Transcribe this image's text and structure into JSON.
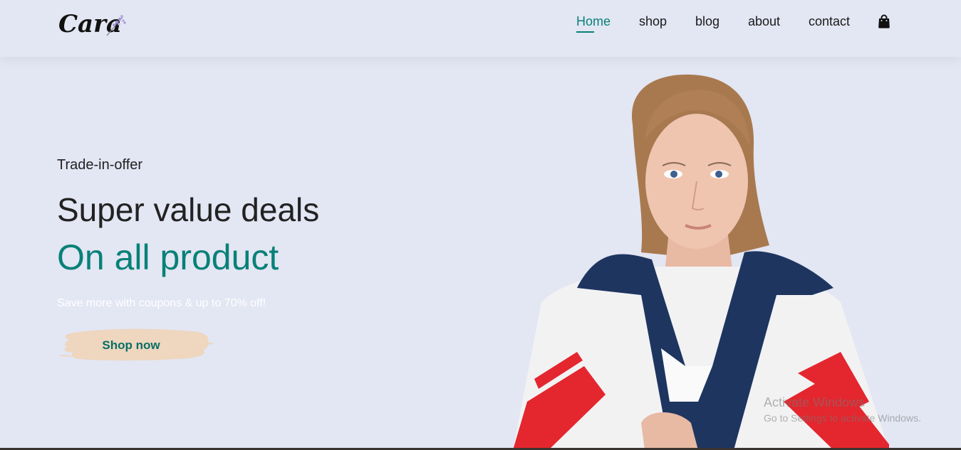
{
  "header": {
    "logo_text": "Cara",
    "nav": [
      {
        "label": "Home",
        "active": true
      },
      {
        "label": "shop"
      },
      {
        "label": "blog"
      },
      {
        "label": "about"
      },
      {
        "label": "contact"
      }
    ],
    "cart_icon": "shopping-bag-icon"
  },
  "hero": {
    "eyebrow": "Trade-in-offer",
    "headline_1": "Super value deals",
    "headline_2": "On all product",
    "subtext": "Save more with coupons & up to 70% off!",
    "button_label": "Shop now",
    "image": "model-in-windbreaker-jacket"
  },
  "watermark": {
    "line_1": "Activate Windows",
    "line_2": "Go to Settings to activate Windows."
  },
  "colors": {
    "background": "#e3e6f3",
    "accent": "#088178",
    "button_brush": "#eed6bf"
  }
}
